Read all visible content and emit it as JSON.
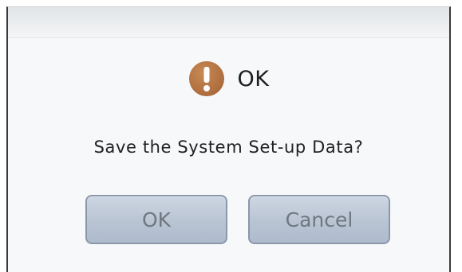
{
  "dialog": {
    "title": "OK",
    "icon": "exclamation-icon",
    "icon_color": "#b3743f",
    "message": "Save the System Set-up Data?"
  },
  "buttons": {
    "ok_label": "OK",
    "cancel_label": "Cancel"
  }
}
